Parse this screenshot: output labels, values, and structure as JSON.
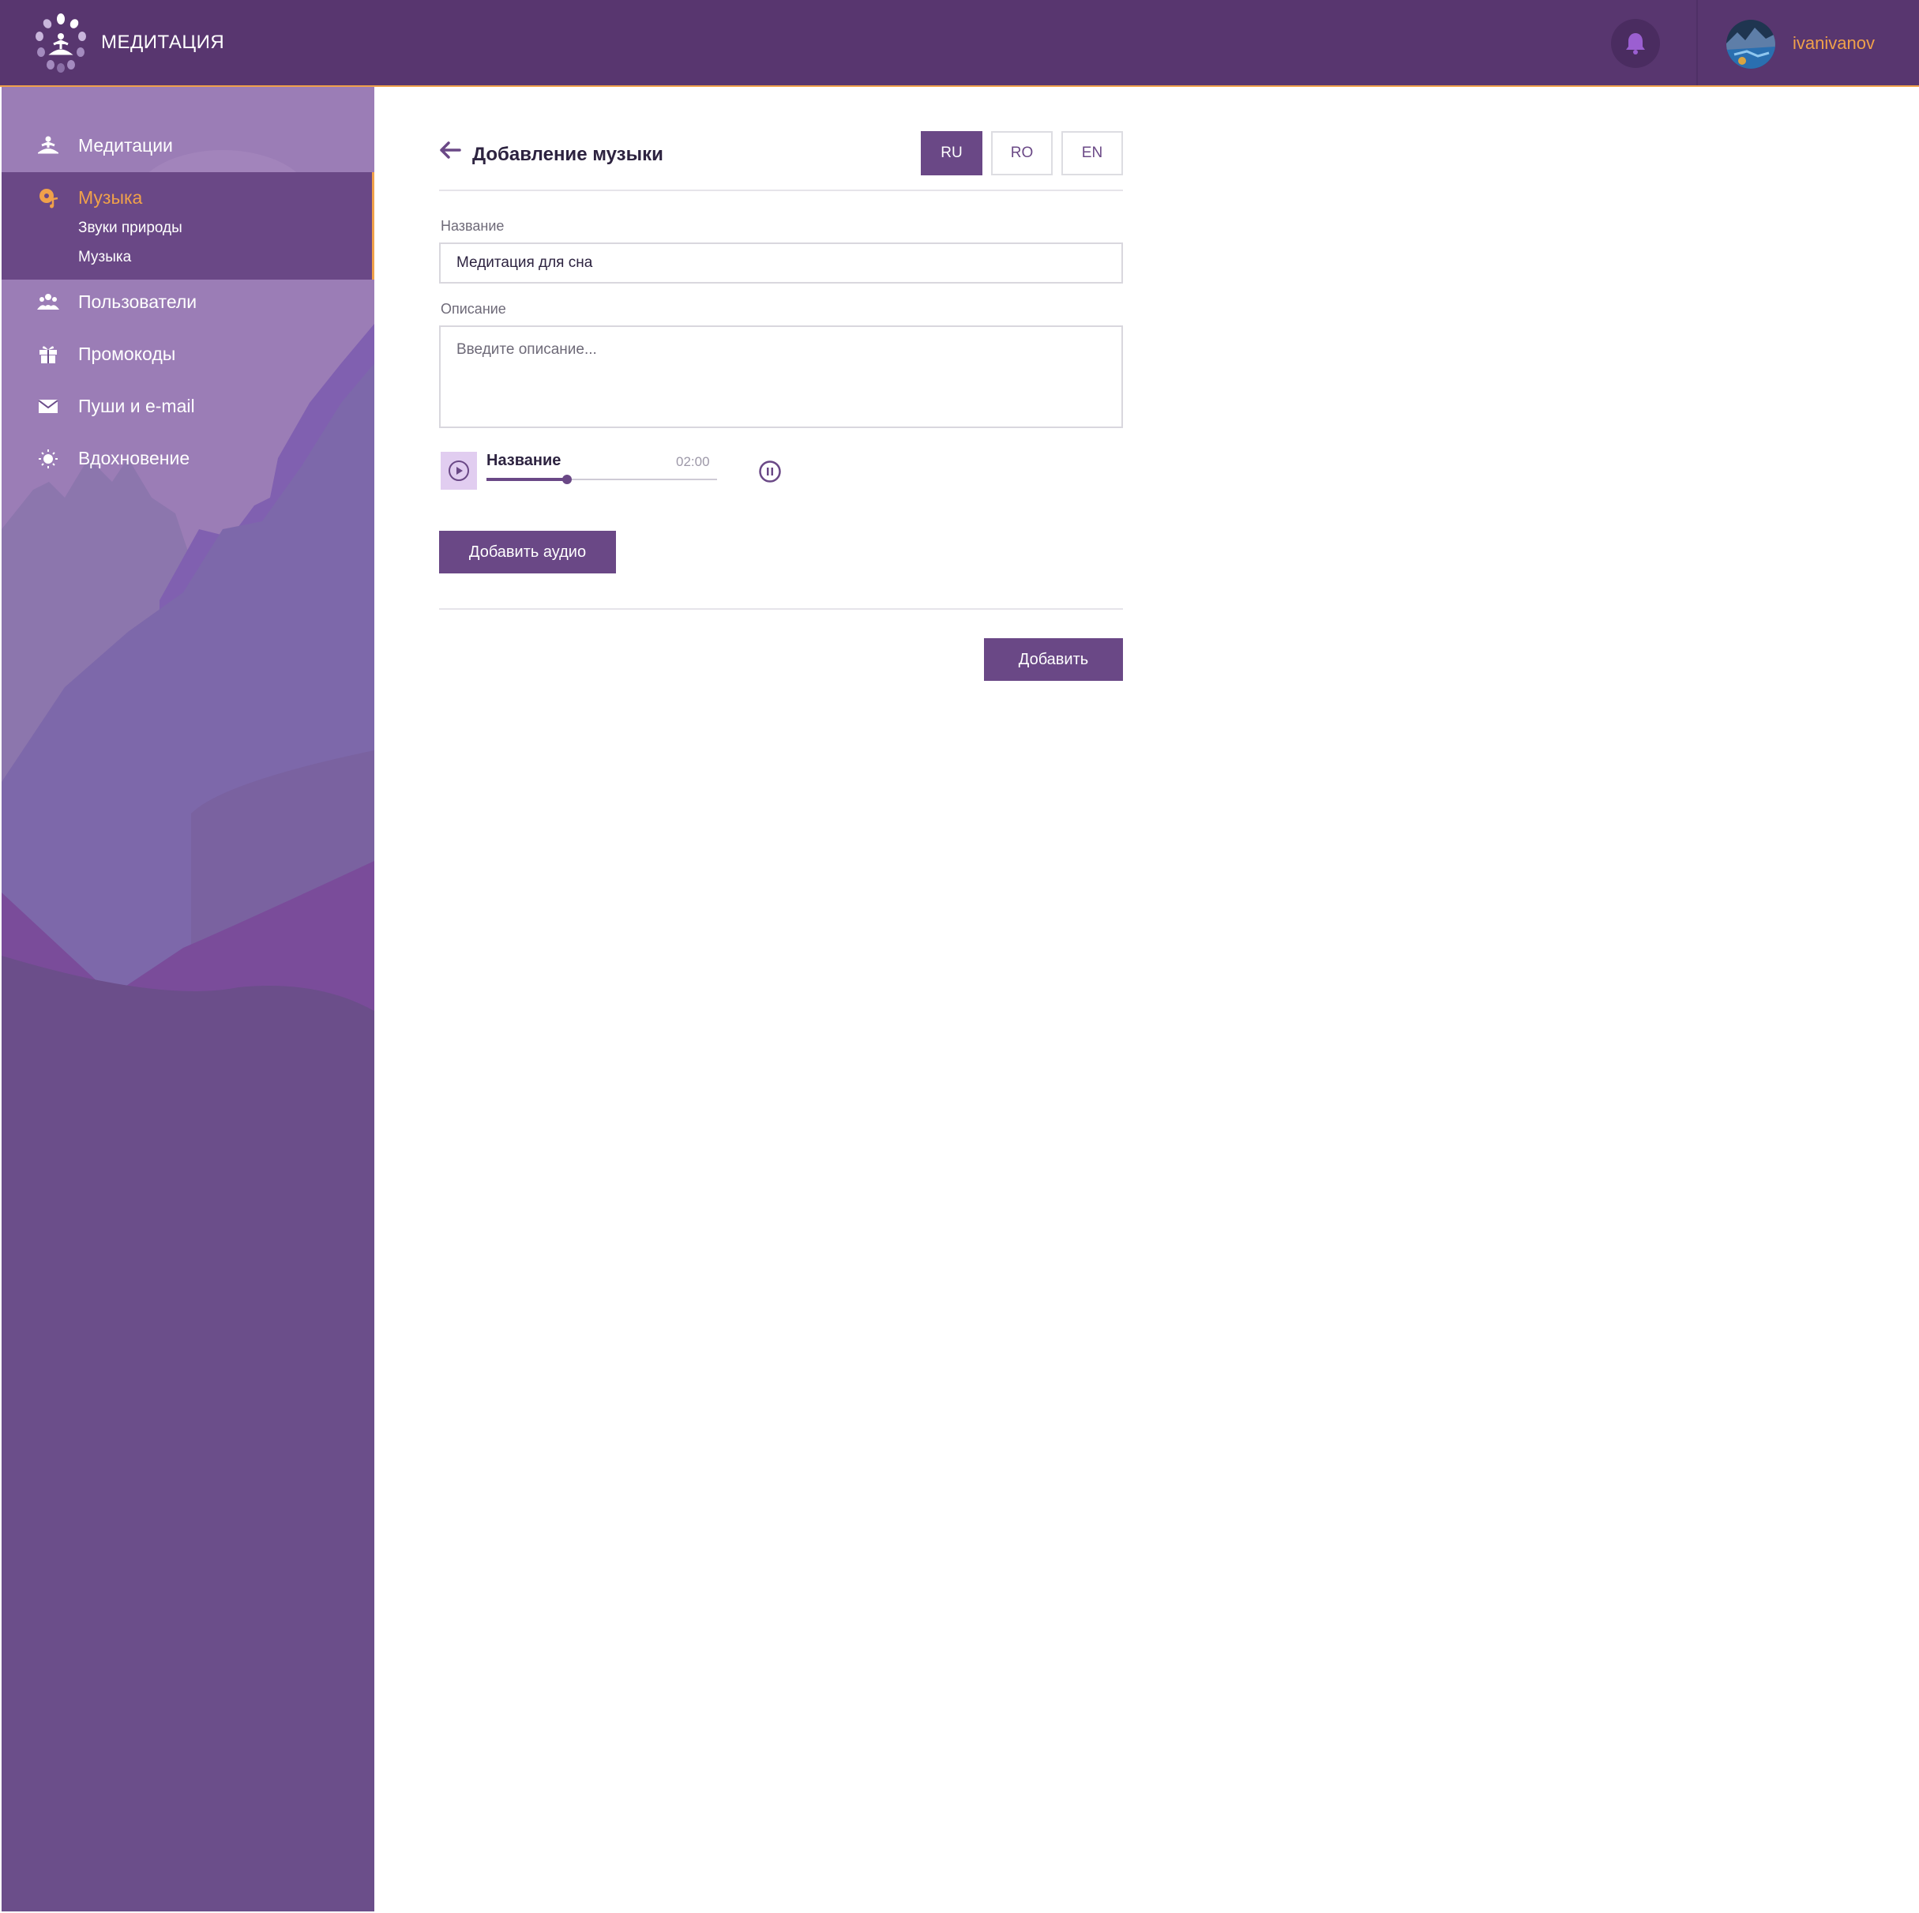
{
  "header": {
    "brand": "МЕДИТАЦИЯ",
    "username": "ivanivanov",
    "logo_icon": "meditation-logo-icon",
    "bell_icon": "bell-icon"
  },
  "sidebar": {
    "items": [
      {
        "label": "Медитации",
        "icon": "meditation-icon"
      },
      {
        "label": "Музыка",
        "icon": "music-icon",
        "active": true,
        "sub_items": [
          "Звуки природы",
          "Музыка"
        ]
      },
      {
        "label": "Пользователи",
        "icon": "users-icon"
      },
      {
        "label": "Промокоды",
        "icon": "gift-icon"
      },
      {
        "label": "Пуши и e-mail",
        "icon": "mail-icon"
      },
      {
        "label": "Вдохновение",
        "icon": "sun-icon"
      }
    ]
  },
  "main": {
    "title": "Добавление музыки",
    "languages": [
      "RU",
      "RO",
      "EN"
    ],
    "active_language": "RU",
    "name_label": "Название",
    "name_value": "Медитация для сна",
    "description_label": "Описание",
    "description_placeholder": "Введите описание...",
    "player": {
      "title": "Название",
      "time": "02:00",
      "progress": 0.35
    },
    "add_audio_label": "Добавить аудио",
    "submit_label": "Добавить"
  },
  "colors": {
    "header_bg": "#58366f",
    "accent": "#f0a14a",
    "primary": "#6a4886",
    "sidebar_bg": "#6b4e8a"
  }
}
